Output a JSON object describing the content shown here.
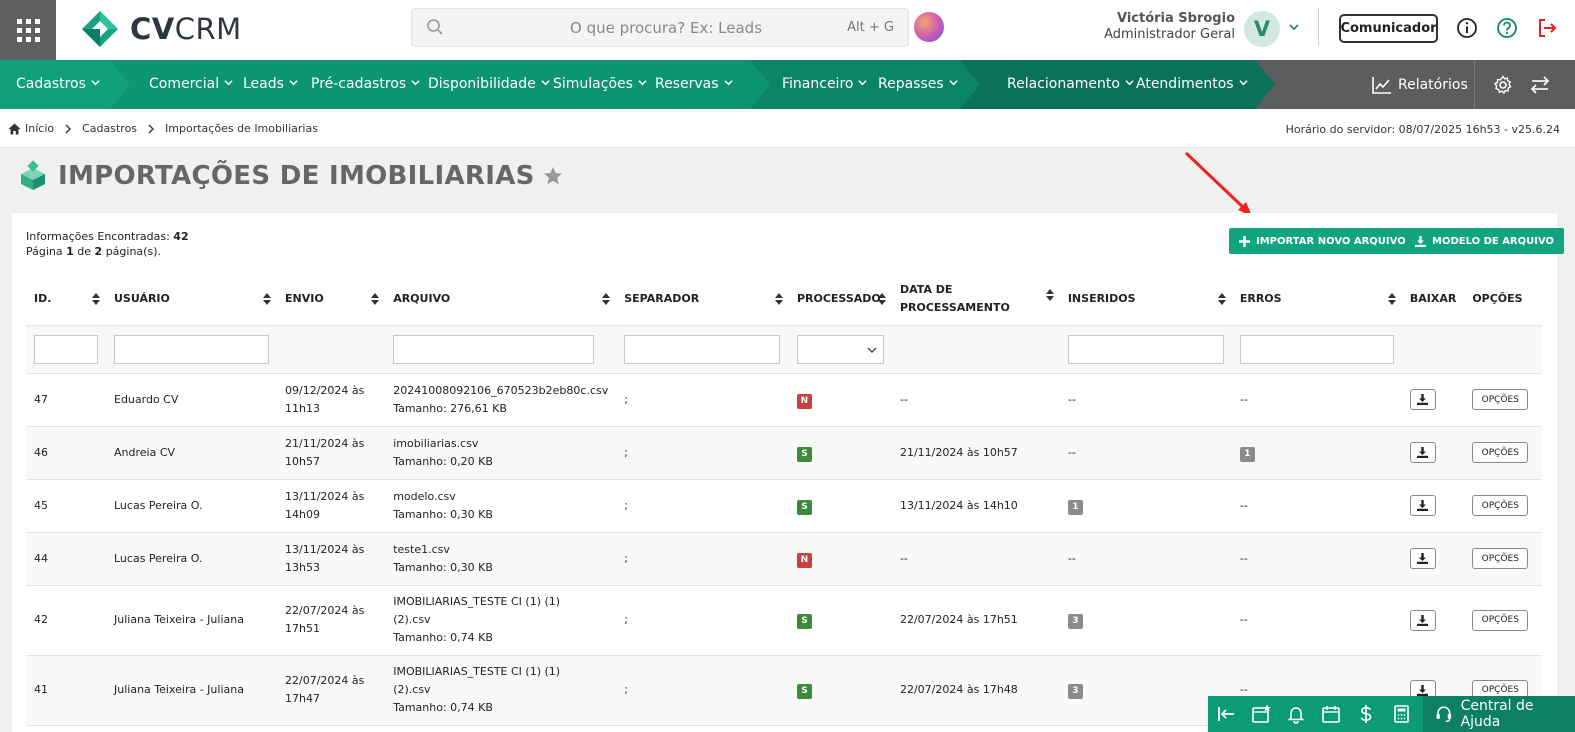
{
  "header": {
    "logo_bold": "CV",
    "logo_light": "CRM",
    "search_placeholder": "O que procura? Ex: Leads",
    "search_shortcut": "Alt + G",
    "user_name": "Victória Sbrogio",
    "user_role": "Administrador Geral",
    "avatar_initial": "V",
    "comunicador_label": "Comunicador"
  },
  "nav": {
    "items": [
      {
        "label": "Cadastros"
      },
      {
        "label": "Comercial"
      },
      {
        "label": "Leads"
      },
      {
        "label": "Pré-cadastros"
      },
      {
        "label": "Disponibilidade"
      },
      {
        "label": "Simulações"
      },
      {
        "label": "Reservas"
      },
      {
        "label": "Financeiro"
      },
      {
        "label": "Repasses"
      },
      {
        "label": "Relacionamento"
      },
      {
        "label": "Atendimentos"
      }
    ],
    "reports_label": "Relatórios"
  },
  "breadcrumb": {
    "home": "Início",
    "level1": "Cadastros",
    "level2": "Importações de Imobiliarias",
    "server_time": "Horário do servidor: 08/07/2025 16h53 - v25.6.24"
  },
  "page": {
    "title": "IMPORTAÇÕES DE IMOBILIARIAS",
    "info_found_label": "Informações Encontradas:",
    "info_found_count": "42",
    "page_word": "Página",
    "page_current": "1",
    "page_of": "de",
    "page_total": "2",
    "page_suffix": "página(s).",
    "import_button": "IMPORTAR NOVO ARQUIVO",
    "template_button": "MODELO DE ARQUIVO"
  },
  "table": {
    "headers": [
      "ID.",
      "USUÁRIO",
      "ENVIO",
      "ARQUIVO",
      "SEPARADOR",
      "PROCESSADO",
      "DATA DE PROCESSAMENTO",
      "INSERIDOS",
      "ERROS",
      "BAIXAR",
      "OPÇÕES"
    ],
    "size_prefix": "Tamanho:",
    "options_label": "OPÇÕES",
    "rows": [
      {
        "id": "47",
        "user": "Eduardo CV",
        "sent_date": "09/12/2024 às",
        "sent_time": "11h13",
        "file": "20241008092106_670523b2eb80c.csv",
        "size": "Tamanho: 276,61 KB",
        "separator": ";",
        "processed": "N",
        "processed_at": "--",
        "inserted": "--",
        "errors": "--"
      },
      {
        "id": "46",
        "user": "Andreia CV",
        "sent_date": "21/11/2024 às",
        "sent_time": "10h57",
        "file": "imobiliarias.csv",
        "size": "Tamanho: 0,20 KB",
        "separator": ";",
        "processed": "S",
        "processed_at": "21/11/2024 às 10h57",
        "inserted": "--",
        "errors": "1"
      },
      {
        "id": "45",
        "user": "Lucas Pereira O.",
        "sent_date": "13/11/2024 às",
        "sent_time": "14h09",
        "file": "modelo.csv",
        "size": "Tamanho: 0,30 KB",
        "separator": ";",
        "processed": "S",
        "processed_at": "13/11/2024 às 14h10",
        "inserted": "1",
        "errors": "--"
      },
      {
        "id": "44",
        "user": "Lucas Pereira O.",
        "sent_date": "13/11/2024 às",
        "sent_time": "13h53",
        "file": "teste1.csv",
        "size": "Tamanho: 0,30 KB",
        "separator": ";",
        "processed": "N",
        "processed_at": "--",
        "inserted": "--",
        "errors": "--"
      },
      {
        "id": "42",
        "user": "Juliana Teixeira - Juliana",
        "sent_date": "22/07/2024 às",
        "sent_time": "17h51",
        "file": "IMOBILIARIAS_TESTE CI (1) (1)",
        "file2": "(2).csv",
        "size": "Tamanho: 0,74 KB",
        "separator": ";",
        "processed": "S",
        "processed_at": "22/07/2024 às 17h51",
        "inserted": "3",
        "errors": "--"
      },
      {
        "id": "41",
        "user": "Juliana Teixeira - Juliana",
        "sent_date": "22/07/2024 às",
        "sent_time": "17h47",
        "file": "IMOBILIARIAS_TESTE CI (1) (1)",
        "file2": "(2).csv",
        "size": "Tamanho: 0,74 KB",
        "separator": ";",
        "processed": "S",
        "processed_at": "22/07/2024 às 17h48",
        "inserted": "3",
        "errors": "--"
      }
    ]
  },
  "dock": {
    "help_label": "Central de Ajuda"
  },
  "colors": {
    "brand_green": "#12a37f",
    "nav_gray": "#5c5d5f",
    "badge_no": "#c9413d",
    "badge_yes": "#3c8a3a"
  }
}
